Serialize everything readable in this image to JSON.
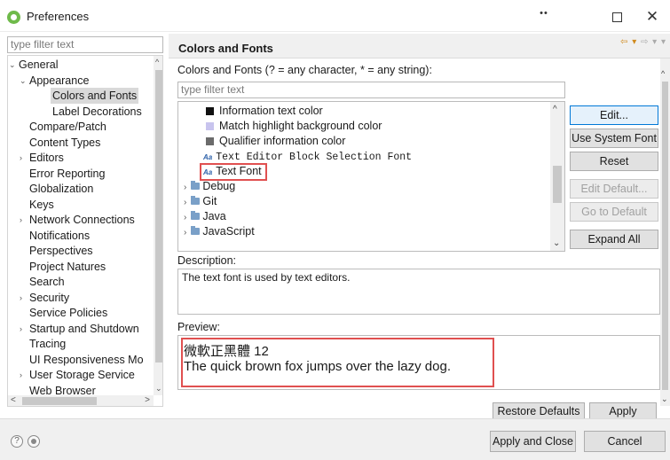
{
  "window": {
    "title": "Preferences",
    "dots": "••",
    "minimize": "—",
    "close": "✕"
  },
  "left": {
    "filter_placeholder": "type filter text",
    "tree": [
      {
        "label": "General",
        "level": 0,
        "twisty": "⌄"
      },
      {
        "label": "Appearance",
        "level": 1,
        "twisty": "⌄"
      },
      {
        "label": "Colors and Fonts",
        "level": 2,
        "twisty": "",
        "selected": true
      },
      {
        "label": "Label Decorations",
        "level": 2,
        "twisty": ""
      },
      {
        "label": "Compare/Patch",
        "level": 1,
        "twisty": ""
      },
      {
        "label": "Content Types",
        "level": 1,
        "twisty": ""
      },
      {
        "label": "Editors",
        "level": 1,
        "twisty": "›"
      },
      {
        "label": "Error Reporting",
        "level": 1,
        "twisty": ""
      },
      {
        "label": "Globalization",
        "level": 1,
        "twisty": ""
      },
      {
        "label": "Keys",
        "level": 1,
        "twisty": ""
      },
      {
        "label": "Network Connections",
        "level": 1,
        "twisty": "›"
      },
      {
        "label": "Notifications",
        "level": 1,
        "twisty": ""
      },
      {
        "label": "Perspectives",
        "level": 1,
        "twisty": ""
      },
      {
        "label": "Project Natures",
        "level": 1,
        "twisty": ""
      },
      {
        "label": "Search",
        "level": 1,
        "twisty": ""
      },
      {
        "label": "Security",
        "level": 1,
        "twisty": "›"
      },
      {
        "label": "Service Policies",
        "level": 1,
        "twisty": ""
      },
      {
        "label": "Startup and Shutdown",
        "level": 1,
        "twisty": "›"
      },
      {
        "label": "Tracing",
        "level": 1,
        "twisty": ""
      },
      {
        "label": "UI Responsiveness Mo",
        "level": 1,
        "twisty": ""
      },
      {
        "label": "User Storage Service",
        "level": 1,
        "twisty": "›"
      },
      {
        "label": "Web Browser",
        "level": 1,
        "twisty": ""
      }
    ],
    "scroll_up": "^",
    "scroll_down": "⌄",
    "scroll_left": "<",
    "scroll_right": ">"
  },
  "page": {
    "title": "Colors and Fonts",
    "nav_back": "⇦ ▾",
    "nav_forward": "⇨ ▾ ▾",
    "colors_label": "Colors and Fonts (? = any character, * = any string):",
    "filter_placeholder": "type filter text",
    "list": [
      {
        "label": "Information text color",
        "kind": "swatch",
        "color": "#111111"
      },
      {
        "label": "Match highlight background color",
        "kind": "swatch",
        "color": "#c8c4ee"
      },
      {
        "label": "Qualifier information color",
        "kind": "swatch",
        "color": "#6b6b6b"
      },
      {
        "label": "Text Editor Block Selection Font",
        "kind": "font-mono"
      },
      {
        "label": "Text Font",
        "kind": "font"
      },
      {
        "label": "Debug",
        "kind": "folder"
      },
      {
        "label": "Git",
        "kind": "folder"
      },
      {
        "label": "Java",
        "kind": "folder"
      },
      {
        "label": "JavaScript",
        "kind": "folder"
      }
    ],
    "font_glyph": "Aa",
    "folder_twisty": "›",
    "scroll_up": "^",
    "scroll_down": "⌄",
    "buttons": {
      "edit": "Edit...",
      "use_system_font": "Use System Font",
      "reset": "Reset",
      "edit_default": "Edit Default...",
      "go_to_default": "Go to Default",
      "expand_all": "Expand All"
    },
    "description_label": "Description:",
    "description_text": "The text font is used by text editors.",
    "preview_label": "Preview:",
    "preview_line1": "微軟正黑體 12",
    "preview_line2": "The quick brown fox jumps over the lazy dog."
  },
  "footer": {
    "restore_defaults": "Restore Defaults",
    "apply": "Apply",
    "apply_and_close": "Apply and Close",
    "cancel": "Cancel",
    "help_glyph": "?"
  },
  "colors": {
    "accent": "#0078d7",
    "highlight_border": "#e05050"
  }
}
